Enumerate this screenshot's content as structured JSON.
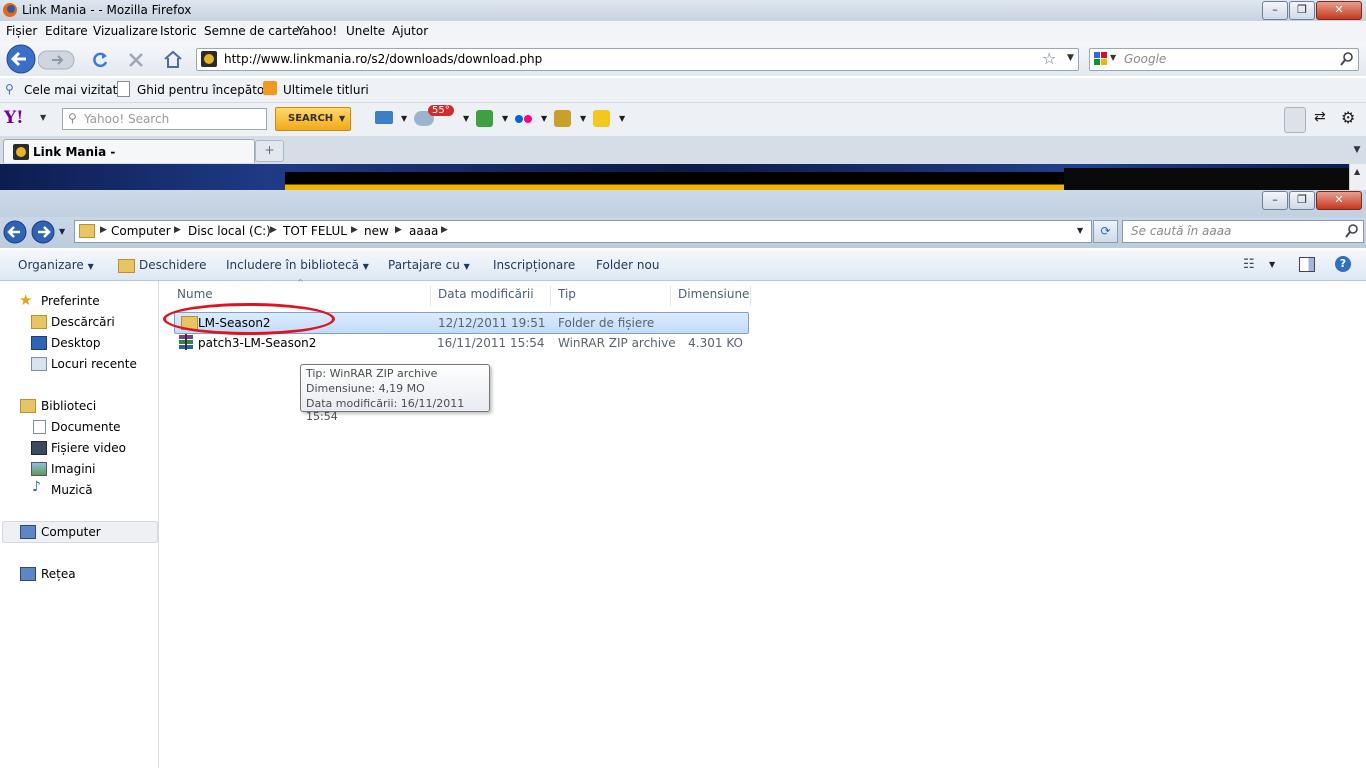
{
  "firefox": {
    "window_title": "Link Mania - - Mozilla Firefox",
    "menu": [
      "Fișier",
      "Editare",
      "Vizualizare",
      "Istoric",
      "Semne de carte",
      "Yahoo!",
      "Unelte",
      "Ajutor"
    ],
    "url": "http://www.linkmania.ro/s2/downloads/download.php",
    "search_placeholder": "Google",
    "bookmarks": [
      "Cele mai vizitate",
      "Ghid pentru începători",
      "Ultimele titluri"
    ],
    "yahoo_search_placeholder": "Yahoo! Search",
    "yahoo_search_button": "SEARCH",
    "weather_badge": "55°",
    "tab_title": "Link Mania -",
    "new_tab": "+"
  },
  "explorer": {
    "breadcrumb": [
      "Computer",
      "Disc local (C:)",
      "TOT FELUL",
      "new",
      "aaaa"
    ],
    "search_placeholder": "Se caută în aaaa",
    "commands": [
      "Organizare",
      "Deschidere",
      "Includere în bibliotecă",
      "Partajare cu",
      "Inscripționare",
      "Folder nou"
    ],
    "nav": {
      "favorites_header": "Preferinte",
      "favorites": [
        "Descărcări",
        "Desktop",
        "Locuri recente"
      ],
      "libraries_header": "Biblioteci",
      "libraries": [
        "Documente",
        "Fișiere video",
        "Imagini",
        "Muzică"
      ],
      "computer": "Computer",
      "network": "Rețea"
    },
    "columns": [
      "Nume",
      "Data modificării",
      "Tip",
      "Dimensiune"
    ],
    "files": [
      {
        "name": "LM-Season2",
        "date": "12/12/2011 19:51",
        "type": "Folder de fișiere",
        "size": ""
      },
      {
        "name": "patch3-LM-Season2",
        "date": "16/11/2011 15:54",
        "type": "WinRAR ZIP archive",
        "size": "4.301 KO"
      }
    ],
    "tooltip": {
      "line1": "Tip: WinRAR ZIP archive",
      "line2": "Dimensiune: 4,19 MO",
      "line3": "Data modificării: 16/11/2011 15:54"
    }
  },
  "colors": {
    "highlight_ellipse": "#e0131e",
    "selection": "#c2dcfb",
    "banner_gold": "#f1b400"
  }
}
